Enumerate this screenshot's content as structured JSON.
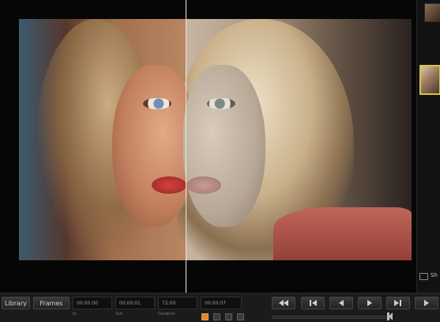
{
  "toolbar": {
    "library_label": "Library",
    "frames_label": "Frames"
  },
  "timecodes": {
    "in": "00:00:00",
    "out": "00:00:01",
    "duration": "72:00",
    "current": "00:00:07"
  },
  "labels": {
    "in": "In",
    "out": "Out",
    "duration": "Duration"
  },
  "side_panel": {
    "label": "Sh"
  },
  "colors": {
    "accent": "#e0832c",
    "thumb_selected": "#d6c24a",
    "split_line": "#e8e8e8"
  }
}
